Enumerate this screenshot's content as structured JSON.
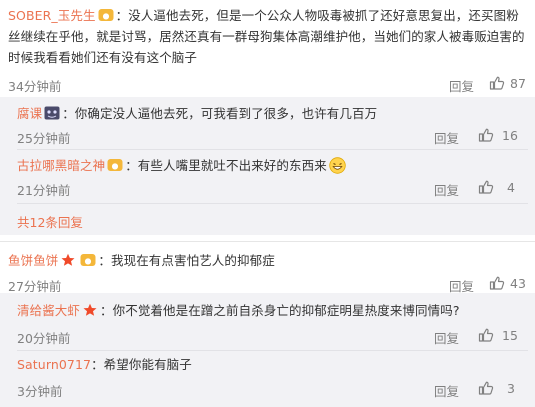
{
  "comments": [
    {
      "user": "SOBER_玉先生",
      "text": "：没人逼他去死，但是一个公众人物吸毒被抓了还好意思复出，还买图粉丝继续在乎他，就是讨骂，居然还真有一群母狗集体高潮维护他，当她们的家人被毒贩迫害的时候我看看她们还有没有这个脑子",
      "time": "34分钟前",
      "reply_label": "回复",
      "likes": "87",
      "replies": [
        {
          "user": "腐课",
          "text": "：你确定没人逼他去死，可我看到了很多，也许有几百万",
          "time": "25分钟前",
          "reply_label": "回复",
          "likes": "16"
        },
        {
          "user": "古拉哪黑暗之神",
          "text": "：有些人嘴里就吐不出来好的东西来",
          "time": "21分钟前",
          "reply_label": "回复",
          "likes": "4"
        }
      ],
      "more_replies": "共12条回复"
    },
    {
      "user": "鱼饼鱼饼",
      "text": "：我现在有点害怕艺人的抑郁症",
      "time": "27分钟前",
      "reply_label": "回复",
      "likes": "43",
      "replies": [
        {
          "user": "清给酱大虾",
          "text": "：你不觉着他是在蹭之前自杀身亡的抑郁症明星热度来博同情吗?",
          "time": "20分钟前",
          "reply_label": "回复",
          "likes": "15"
        },
        {
          "user": "Saturn0717",
          "text": "：希望你能有脑子",
          "time": "3分钟前",
          "reply_label": "回复",
          "likes": "3"
        }
      ]
    }
  ],
  "colors": {
    "username": "#eb7350",
    "meta": "#808080",
    "reply_bg": "#f2f2f5",
    "text": "#333333"
  },
  "icons": {
    "like": "thumbs-up-icon",
    "vip": "vip-badge-icon",
    "star": "star-badge-icon",
    "emoji": "grin-emoji-icon",
    "sticker": "sticker-icon"
  }
}
